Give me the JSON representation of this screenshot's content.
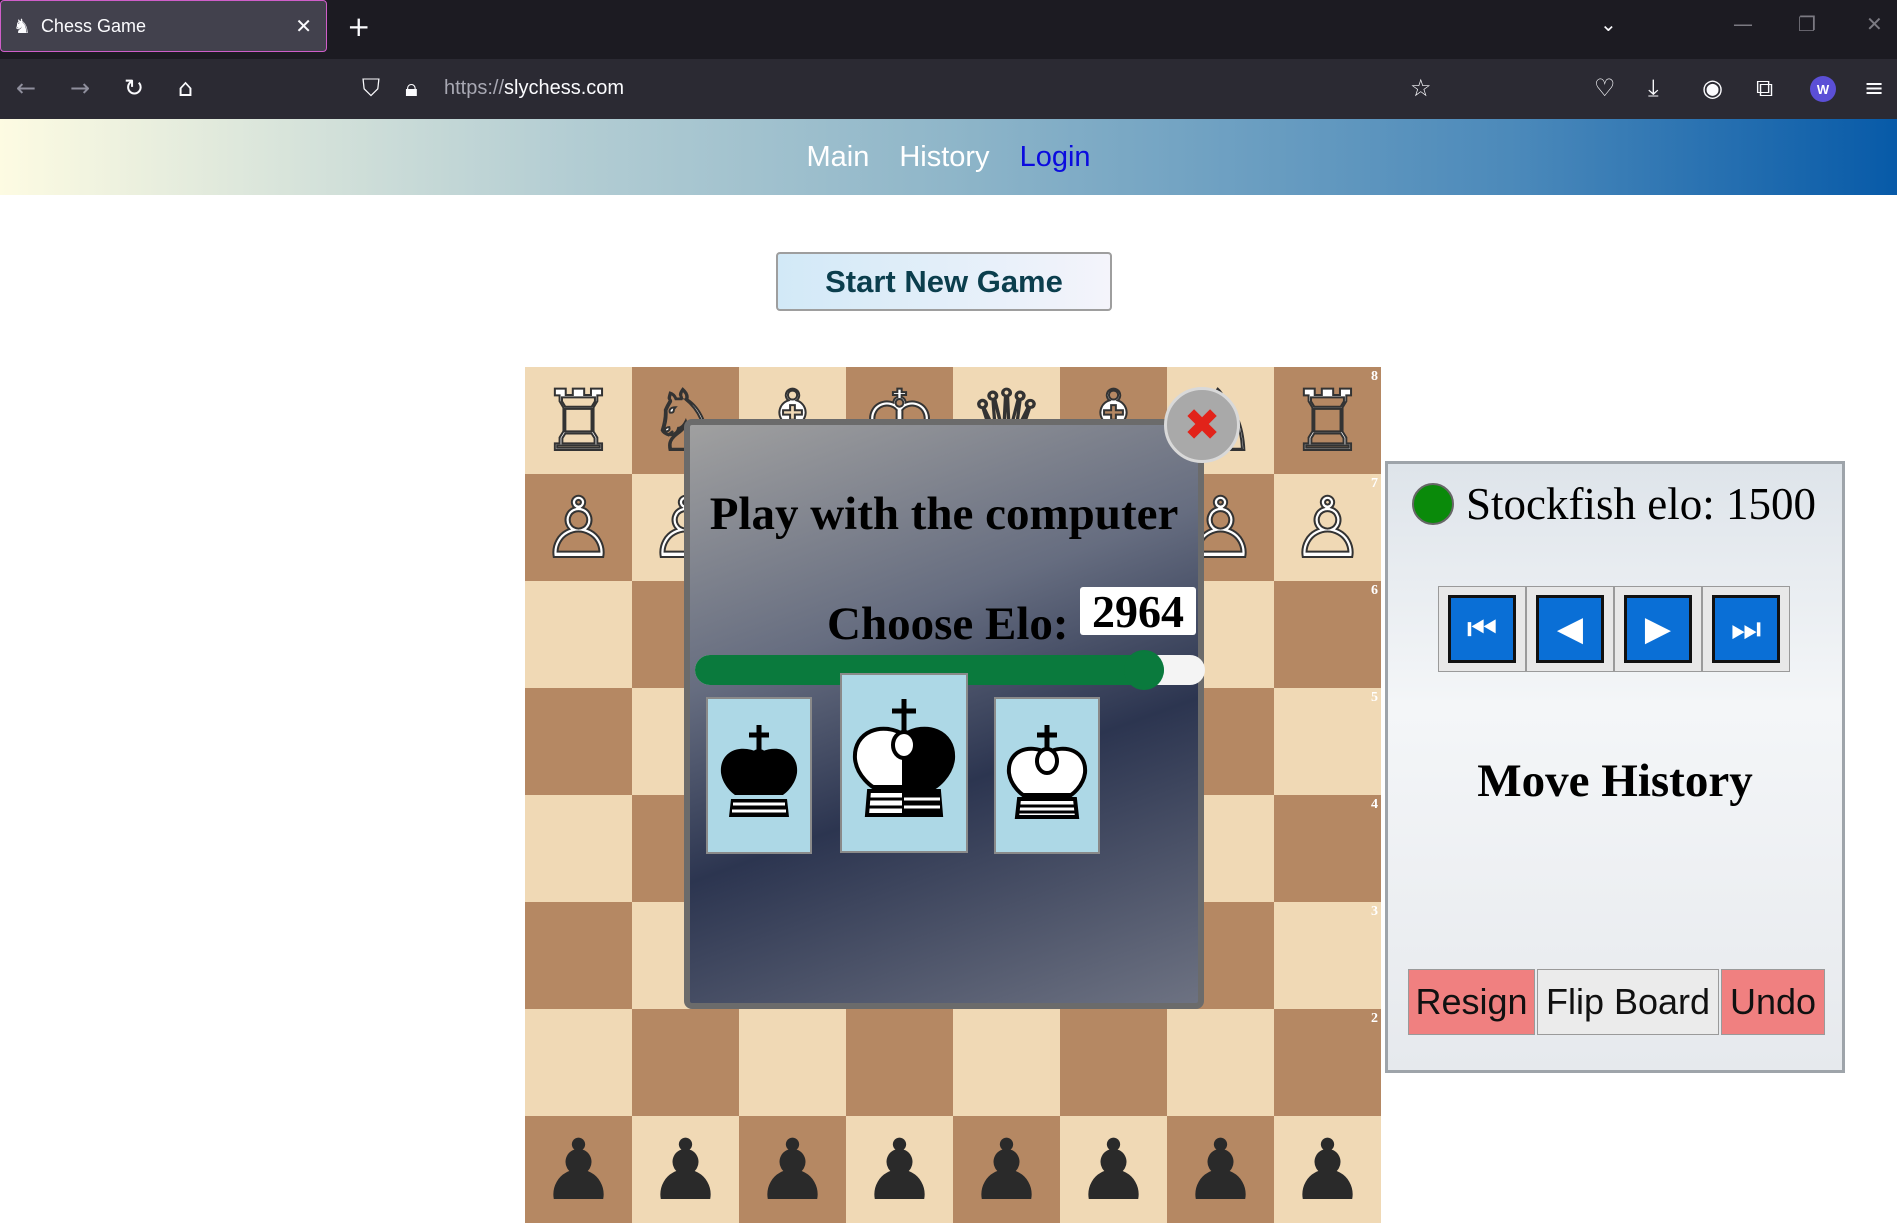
{
  "browser": {
    "tab_title": "Chess Game",
    "tab_icon": "♞",
    "new_tab": "+",
    "url_protocol": "https://",
    "url_host": "slychess.com",
    "avatar_letter": "W"
  },
  "site_nav": {
    "items": [
      "Main",
      "History",
      "Login"
    ]
  },
  "start_button": "Start New Game",
  "board": {
    "rank8": [
      "♖",
      "♘",
      "♗",
      "♔",
      "♕",
      "♗",
      "♘",
      "♖"
    ],
    "rank7": [
      "♙",
      "♙",
      "♙",
      "♙",
      "♙",
      "♙",
      "♙",
      "♙"
    ],
    "rank2": [
      "♟",
      "♟",
      "♟",
      "♟",
      "♟",
      "♟",
      "♟",
      "♟"
    ],
    "rank_labels": [
      "8",
      "7",
      "6",
      "5",
      "4",
      "3",
      "2"
    ]
  },
  "modal": {
    "title": "Play with the computer",
    "elo_label": "Choose Elo:",
    "elo_value": "2964",
    "elo_fraction": 0.88,
    "close_symbol": "✖",
    "color_options": [
      "black",
      "random",
      "white"
    ]
  },
  "side_panel": {
    "engine_label": "Stockfish elo: 1500",
    "nav_buttons": [
      "⏮",
      "◀",
      "▶",
      "⏭"
    ],
    "move_history_title": "Move History",
    "resign": "Resign",
    "flip_board": "Flip Board",
    "undo": "Undo"
  },
  "colors": {
    "light_square": "#f0d9b5",
    "dark_square": "#b58863",
    "slider_green": "#0a7a3d",
    "button_red": "#f08080"
  }
}
